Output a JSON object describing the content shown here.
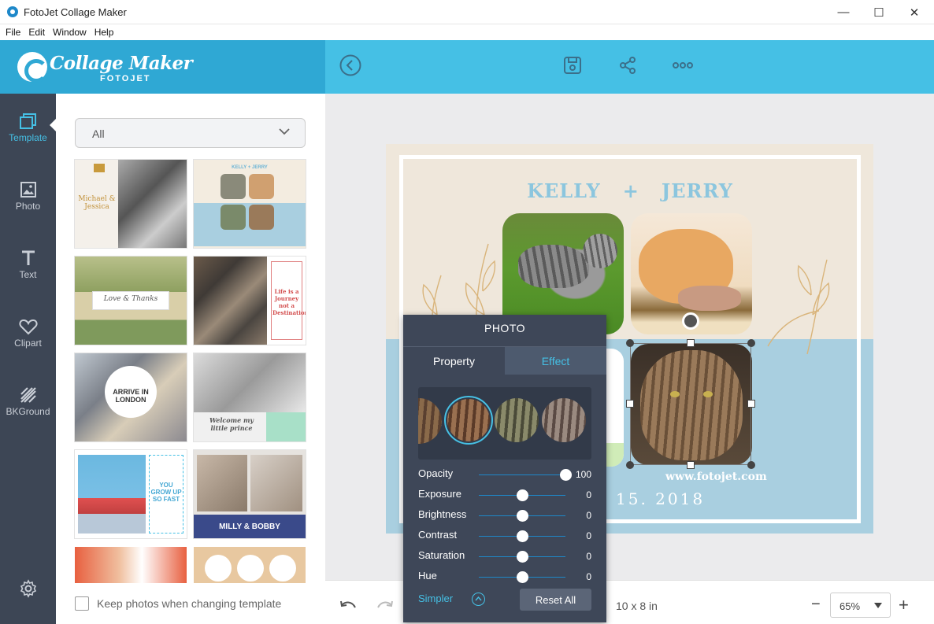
{
  "window": {
    "title": "FotoJet Collage Maker",
    "minimize": "—",
    "maximize": "☐",
    "close": "✕"
  },
  "menu": [
    "File",
    "Edit",
    "Window",
    "Help"
  ],
  "logo": {
    "main": "Collage Maker",
    "sub": "FOTOJET"
  },
  "nav": [
    {
      "label": "Template",
      "icon": "template-icon",
      "active": true
    },
    {
      "label": "Photo",
      "icon": "photo-icon"
    },
    {
      "label": "Text",
      "icon": "text-icon"
    },
    {
      "label": "Clipart",
      "icon": "heart-icon"
    },
    {
      "label": "BKGround",
      "icon": "background-icon"
    }
  ],
  "template_panel": {
    "category": "All",
    "keep_photos_label": "Keep photos when changing template",
    "thumbs": [
      {
        "text": "Michael & Jessica"
      },
      {
        "text": "KELLY + JERRY"
      },
      {
        "text": "Love & Thanks"
      },
      {
        "text": "Life is a Journey not a Destination"
      },
      {
        "text": "ARRIVE IN LONDON"
      },
      {
        "text": "Welcome my little prince"
      },
      {
        "text": "YOU GROW UP SO FAST"
      },
      {
        "text": "MILLY & BOBBY"
      },
      {
        "text": ""
      },
      {
        "text": ""
      }
    ]
  },
  "collage": {
    "title_left": "KELLY",
    "title_plus": "+",
    "title_right": "JERRY",
    "site": "www.fotojet.com",
    "date": "15. 2018"
  },
  "photo_panel": {
    "title": "PHOTO",
    "tab_property": "Property",
    "tab_effect": "Effect",
    "active_tab": "Effect",
    "sliders": [
      {
        "label": "Opacity",
        "value": "100"
      },
      {
        "label": "Exposure",
        "value": "0"
      },
      {
        "label": "Brightness",
        "value": "0"
      },
      {
        "label": "Contrast",
        "value": "0"
      },
      {
        "label": "Saturation",
        "value": "0"
      },
      {
        "label": "Hue",
        "value": "0"
      }
    ],
    "simpler_label": "Simpler",
    "reset_label": "Reset All"
  },
  "bottom": {
    "size": "10 x 8 in",
    "zoom": "65%",
    "zoom_out": "−",
    "zoom_in": "+"
  },
  "colors": {
    "accent": "#45c0e5",
    "sidebar": "#3d4655",
    "panel": "#3e4758"
  }
}
